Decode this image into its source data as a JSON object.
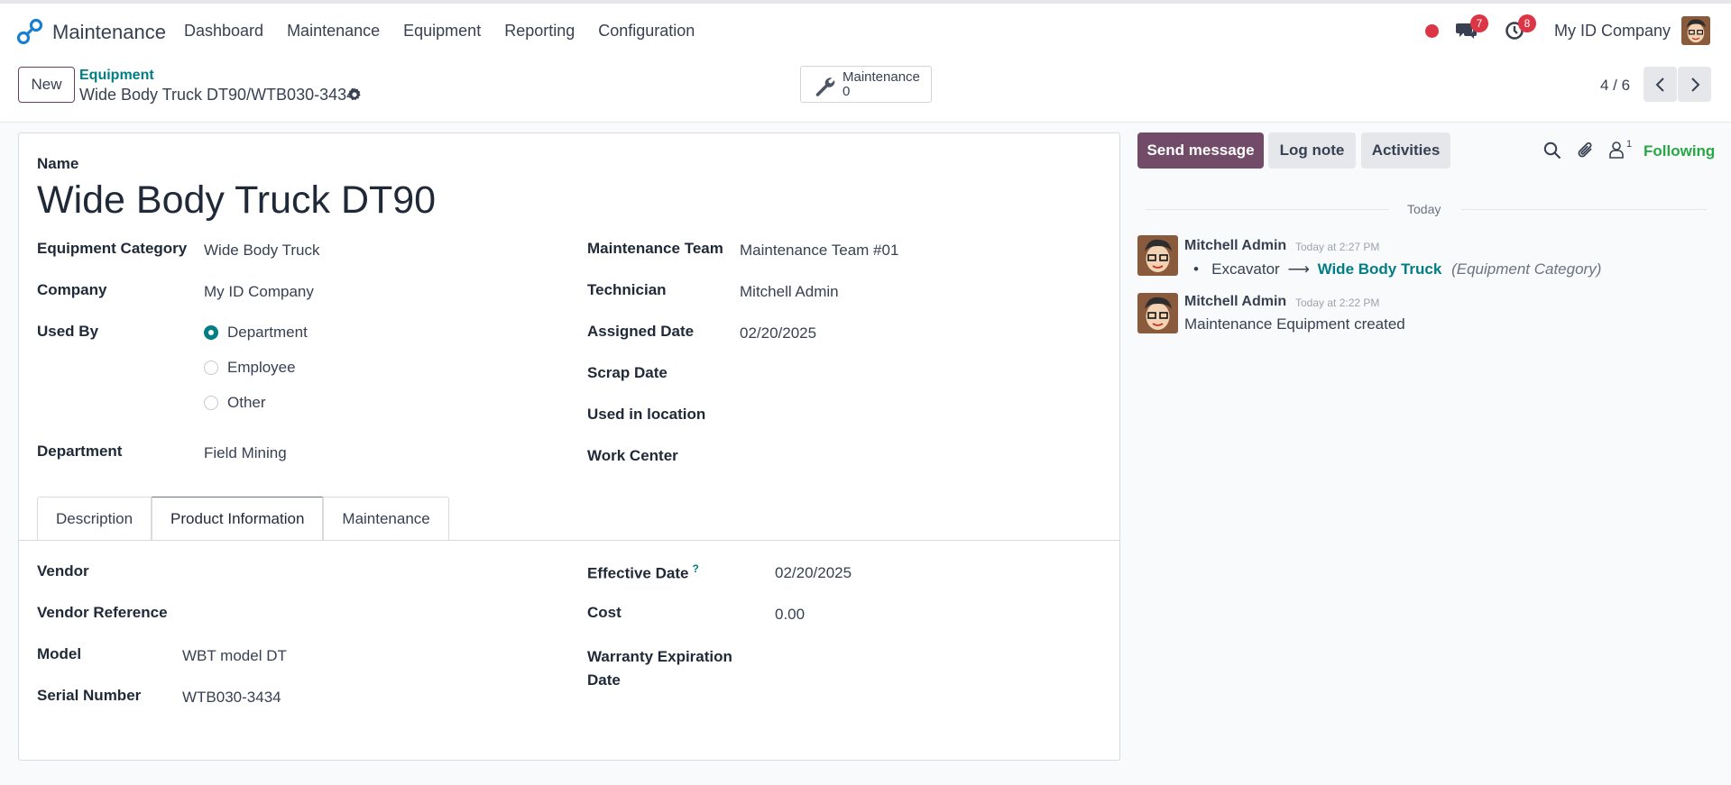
{
  "navbar": {
    "app_name": "Maintenance",
    "menu": [
      "Dashboard",
      "Maintenance",
      "Equipment",
      "Reporting",
      "Configuration"
    ],
    "chat_badge": "7",
    "activity_badge": "8",
    "company": "My ID Company"
  },
  "control": {
    "new_label": "New",
    "breadcrumb_parent": "Equipment",
    "breadcrumb_current": "Wide Body Truck DT90/WTB030-3434",
    "smart_button": {
      "label": "Maintenance",
      "count": "0"
    },
    "pager": "4 / 6"
  },
  "form": {
    "name_label": "Name",
    "name_value": "Wide Body Truck DT90",
    "left_fields": {
      "equipment_category": {
        "label": "Equipment Category",
        "value": "Wide Body Truck"
      },
      "company": {
        "label": "Company",
        "value": "My ID Company"
      },
      "used_by": {
        "label": "Used By",
        "options": [
          "Department",
          "Employee",
          "Other"
        ],
        "selected": "Department"
      },
      "department": {
        "label": "Department",
        "value": "Field Mining"
      }
    },
    "right_fields": {
      "maintenance_team": {
        "label": "Maintenance Team",
        "value": "Maintenance Team #01"
      },
      "technician": {
        "label": "Technician",
        "value": "Mitchell Admin"
      },
      "assigned_date": {
        "label": "Assigned Date",
        "value": "02/20/2025"
      },
      "scrap_date": {
        "label": "Scrap Date",
        "value": ""
      },
      "used_in_location": {
        "label": "Used in location",
        "value": ""
      },
      "work_center": {
        "label": "Work Center",
        "value": ""
      }
    },
    "tabs": [
      "Description",
      "Product Information",
      "Maintenance"
    ],
    "active_tab": "Product Information",
    "product_info": {
      "vendor": {
        "label": "Vendor",
        "value": ""
      },
      "vendor_reference": {
        "label": "Vendor Reference",
        "value": ""
      },
      "model": {
        "label": "Model",
        "value": "WBT model DT"
      },
      "serial_number": {
        "label": "Serial Number",
        "value": "WTB030-3434"
      },
      "effective_date": {
        "label": "Effective Date",
        "help": "?",
        "value": "02/20/2025"
      },
      "cost": {
        "label": "Cost",
        "value": "0.00"
      },
      "warranty_expiration_line1": "Warranty Expiration",
      "warranty_expiration_line2": "Date"
    }
  },
  "chatter": {
    "send_message": "Send message",
    "log_note": "Log note",
    "activities": "Activities",
    "followers_count": "1",
    "following": "Following",
    "date_separator": "Today",
    "messages": [
      {
        "author": "Mitchell Admin",
        "time": "Today at 2:27 PM",
        "old_value": "Excavator",
        "new_value": "Wide Body Truck",
        "field": "(Equipment Category)"
      },
      {
        "author": "Mitchell Admin",
        "time": "Today at 2:22 PM",
        "body": "Maintenance Equipment created"
      }
    ]
  },
  "colors": {
    "primary": "#714b67",
    "accent": "#017e84",
    "following": "#28a745",
    "badge": "#dc3545"
  }
}
